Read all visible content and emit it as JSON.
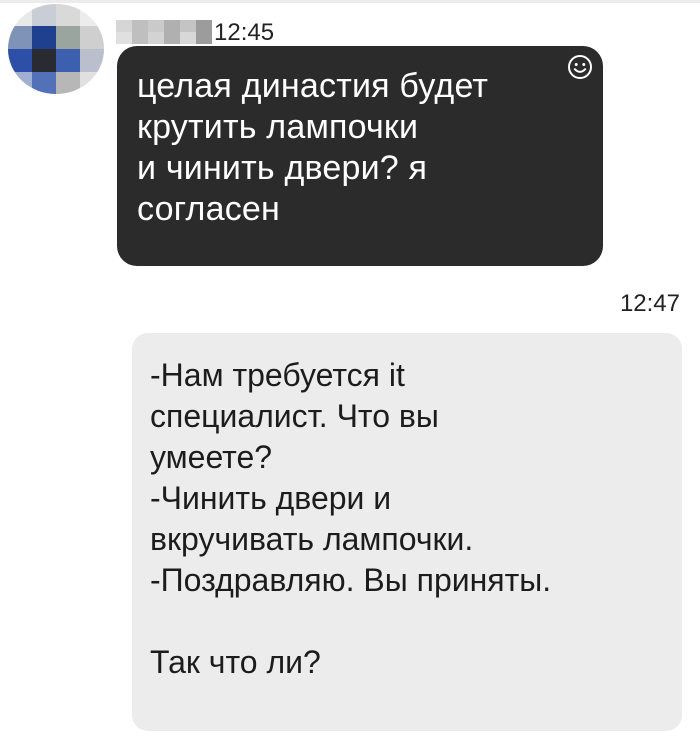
{
  "conversation": {
    "incoming": {
      "time": "12:45",
      "text": "целая династия будет\nкрутить лампочки\nи чинить двери? я\nсогласен",
      "icons": {
        "avatar": "avatar-pixelated",
        "reaction": "smiley-icon"
      }
    },
    "outgoing": {
      "time": "12:47",
      "text": "-Нам требуется it\nспециалист. Что вы\nумеете?\n-Чинить двери и\nвкручивать лампочки.\n-Поздравляю. Вы приняты.\n\nТак что ли?"
    }
  },
  "colors": {
    "incoming_bubble": "#2b2b2b",
    "outgoing_bubble": "#ececec",
    "background": "#ffffff"
  }
}
